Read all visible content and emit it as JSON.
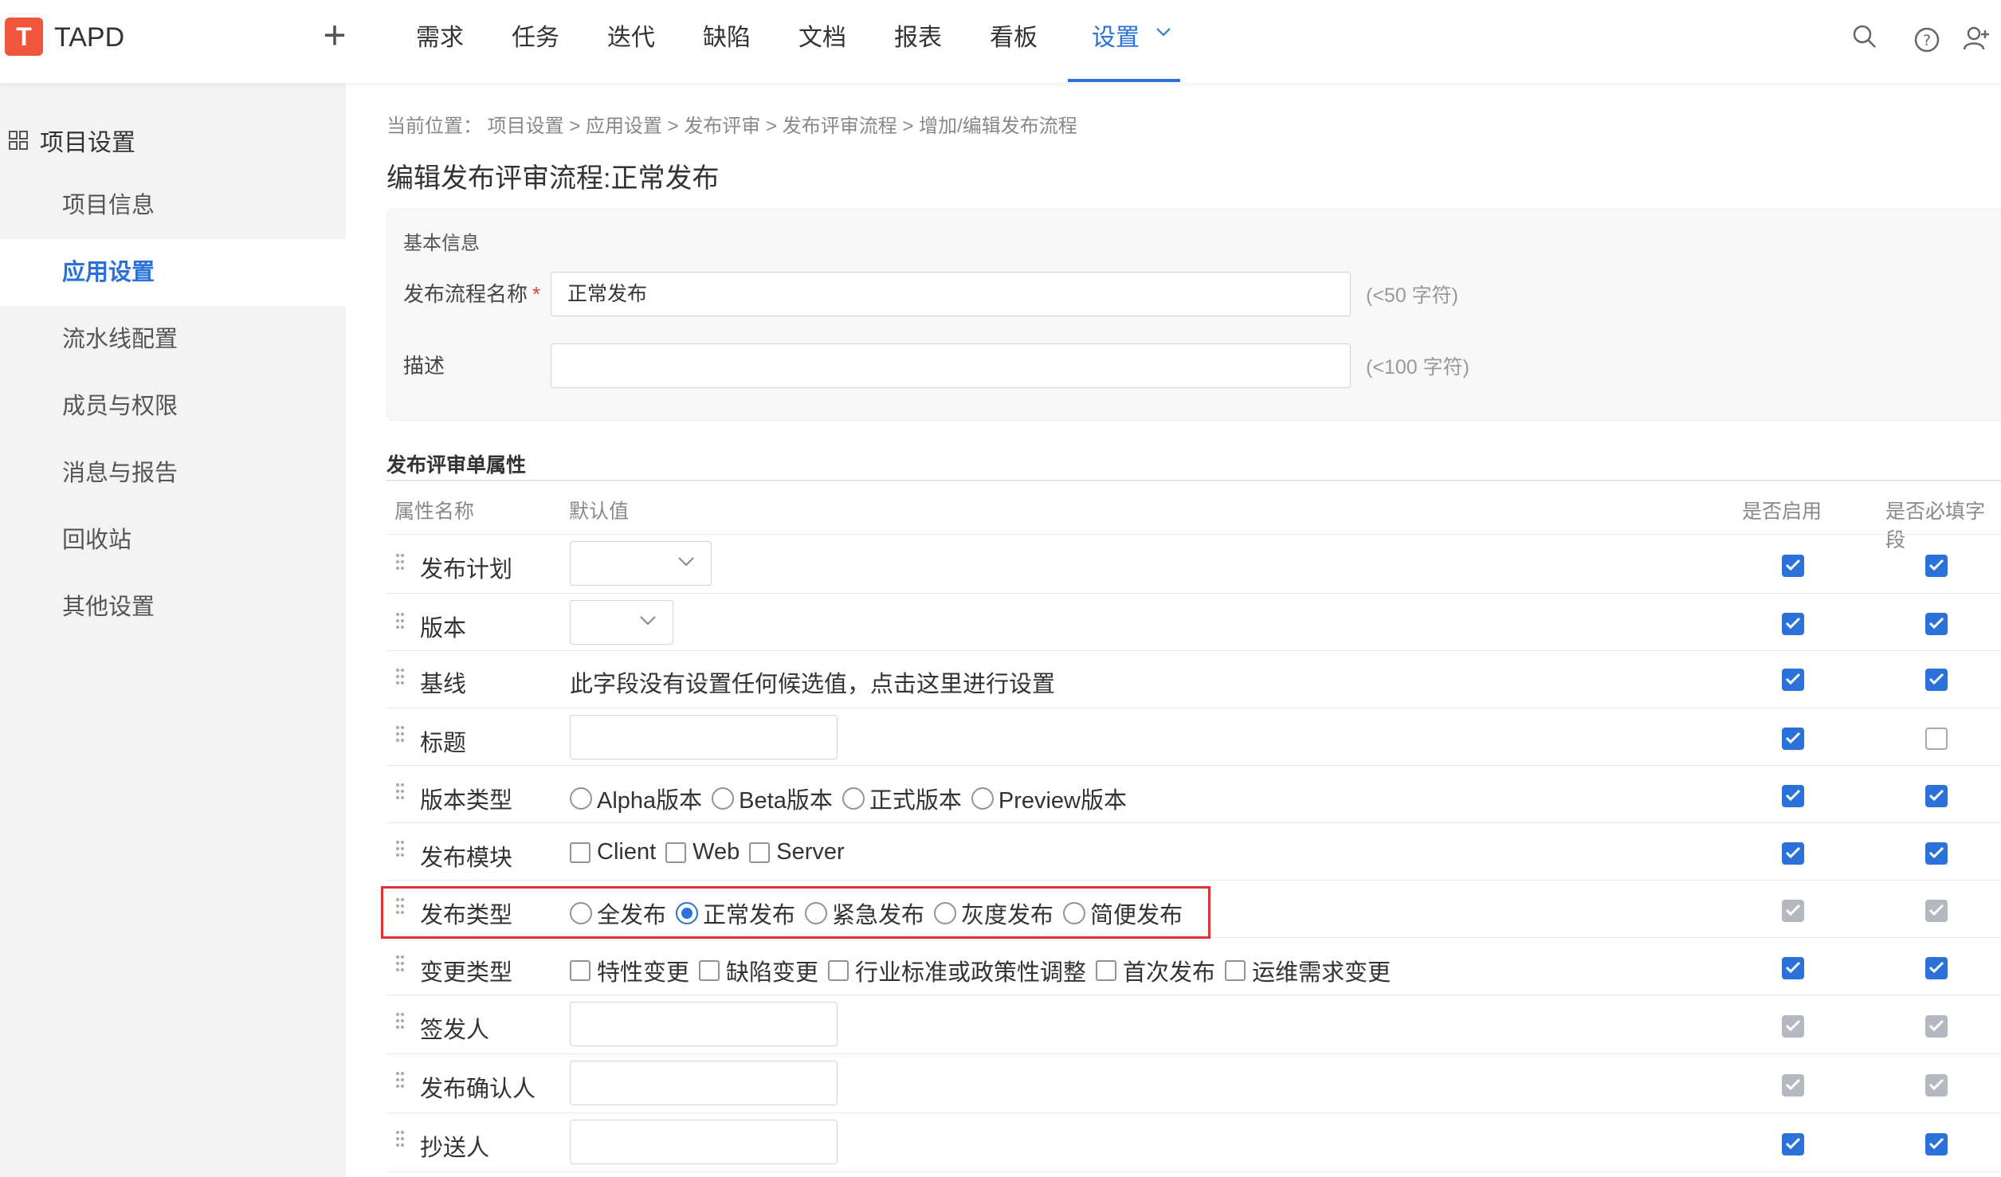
{
  "app": {
    "logo_letter": "T",
    "name": "TAPD"
  },
  "nav": {
    "items": [
      "需求",
      "任务",
      "迭代",
      "缺陷",
      "文档",
      "报表",
      "看板"
    ],
    "active": "设置"
  },
  "icons": [
    "plus-icon",
    "search-icon",
    "help-icon",
    "user-add-icon",
    "chevron-down-icon",
    "grid-icon",
    "drag-handle-icon",
    "check-icon"
  ],
  "sidebar": {
    "header": "项目设置",
    "items": [
      {
        "label": "项目信息",
        "active": false
      },
      {
        "label": "应用设置",
        "active": true
      },
      {
        "label": "流水线配置",
        "active": false
      },
      {
        "label": "成员与权限",
        "active": false
      },
      {
        "label": "消息与报告",
        "active": false
      },
      {
        "label": "回收站",
        "active": false
      },
      {
        "label": "其他设置",
        "active": false
      }
    ]
  },
  "breadcrumb": "当前位置： 项目设置 > 应用设置 > 发布评审 > 发布评审流程 > 增加/编辑发布流程",
  "page_title": "编辑发布评审流程:正常发布",
  "basic": {
    "title": "基本信息",
    "name_label": "发布流程名称",
    "required_mark": "*",
    "name_value": "正常发布",
    "name_hint": "(<50 字符)",
    "desc_label": "描述",
    "desc_value": "",
    "desc_hint": "(<100 字符)"
  },
  "attributes": {
    "title": "发布评审单属性",
    "headers": {
      "name": "属性名称",
      "default": "默认值",
      "enabled": "是否启用",
      "required": "是否必填字段"
    },
    "rows": {
      "plan": {
        "label": "发布计划",
        "enabled": "on",
        "required": "on"
      },
      "version": {
        "label": "版本",
        "enabled": "on",
        "required": "on"
      },
      "baseline": {
        "label": "基线",
        "value": "此字段没有设置任何候选值，点击这里进行设置",
        "enabled": "on",
        "required": "on"
      },
      "title": {
        "label": "标题",
        "enabled": "on",
        "required": "off"
      },
      "version_type": {
        "label": "版本类型",
        "options": [
          "Alpha版本",
          "Beta版本",
          "正式版本",
          "Preview版本"
        ],
        "enabled": "on",
        "required": "on"
      },
      "module": {
        "label": "发布模块",
        "options": [
          "Client",
          "Web",
          "Server"
        ],
        "enabled": "on",
        "required": "on"
      },
      "release_type": {
        "label": "发布类型",
        "options": [
          "全发布",
          "正常发布",
          "紧急发布",
          "灰度发布",
          "简便发布"
        ],
        "selected": "正常发布",
        "enabled": "disabled",
        "required": "disabled"
      },
      "change_type": {
        "label": "变更类型",
        "options": [
          "特性变更",
          "缺陷变更",
          "行业标准或政策性调整",
          "首次发布",
          "运维需求变更"
        ],
        "enabled": "on",
        "required": "on"
      },
      "signer": {
        "label": "签发人",
        "enabled": "disabled",
        "required": "disabled"
      },
      "confirmer": {
        "label": "发布确认人",
        "enabled": "disabled",
        "required": "disabled"
      },
      "cc": {
        "label": "抄送人",
        "enabled": "on",
        "required": "on"
      }
    }
  },
  "colors": {
    "accent": "#2a72d9",
    "logo": "#f0563b",
    "highlight": "#e03232",
    "sidebar_bg": "#f2f3f5"
  }
}
